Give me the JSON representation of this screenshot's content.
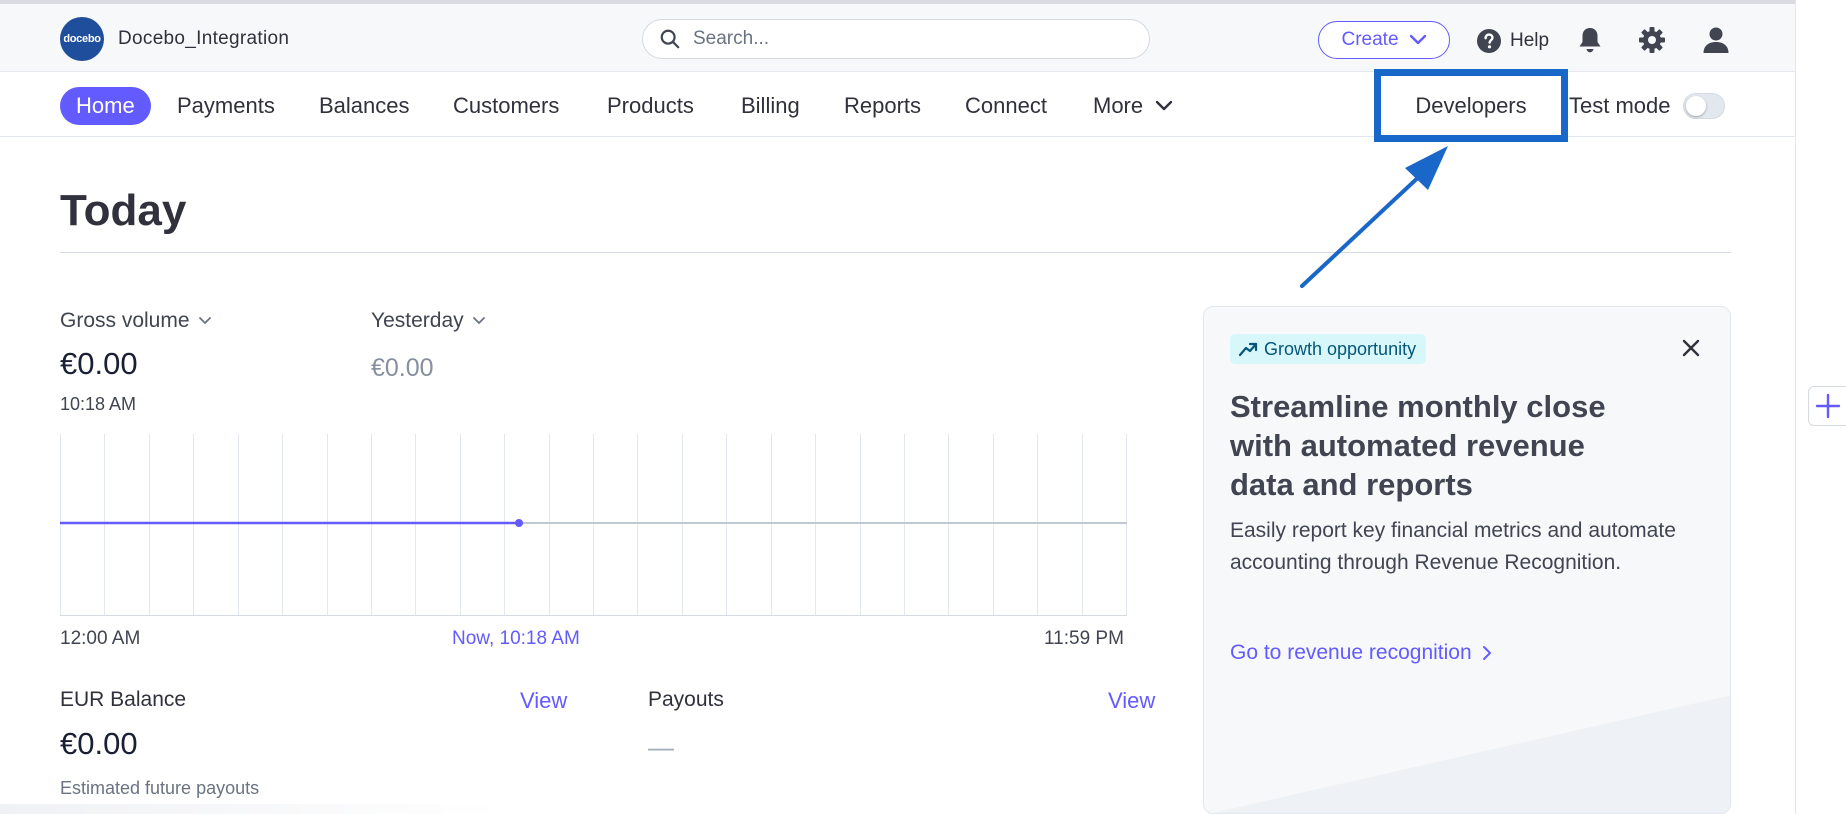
{
  "app": {
    "account_name": "Docebo_Integration",
    "logo_text": "docebo"
  },
  "search": {
    "placeholder": "Search..."
  },
  "header": {
    "create_label": "Create",
    "help_label": "Help",
    "icons": [
      "search-icon",
      "chevron-down-icon",
      "help-icon",
      "bell-icon",
      "gear-icon",
      "user-icon"
    ]
  },
  "nav": {
    "items": [
      "Home",
      "Payments",
      "Balances",
      "Customers",
      "Products",
      "Billing",
      "Reports",
      "Connect",
      "More"
    ],
    "active": "Home",
    "developers_label": "Developers",
    "test_mode_label": "Test mode",
    "test_mode_on": false
  },
  "main": {
    "title": "Today",
    "gross_volume": {
      "label": "Gross volume",
      "value": "€0.00",
      "time": "10:18 AM"
    },
    "yesterday": {
      "label": "Yesterday",
      "value": "€0.00"
    },
    "chart_axis": {
      "start": "12:00 AM",
      "now": "Now, 10:18 AM",
      "end": "11:59 PM"
    },
    "balance": {
      "label": "EUR Balance",
      "view": "View",
      "value": "€0.00",
      "sub": "Estimated future payouts"
    },
    "payouts": {
      "label": "Payouts",
      "view": "View",
      "value": "—"
    }
  },
  "chart_data": {
    "type": "line",
    "x_range": [
      "12:00 AM",
      "11:59 PM"
    ],
    "now_marker": "Now, 10:18 AM",
    "series": [
      {
        "values": [
          0,
          0
        ]
      }
    ],
    "now_fraction_of_day": 0.43,
    "grid": true
  },
  "card": {
    "badge": "Growth opportunity",
    "heading": "Streamline monthly close with automated revenue data and reports",
    "body": "Easily report key financial metrics and automate accounting through Revenue Recognition.",
    "link": "Go to revenue recognition"
  },
  "colors": {
    "accent": "#635bff",
    "annotation": "#1967c9",
    "text": "#30313d",
    "badge_bg": "#d7f7fb"
  }
}
